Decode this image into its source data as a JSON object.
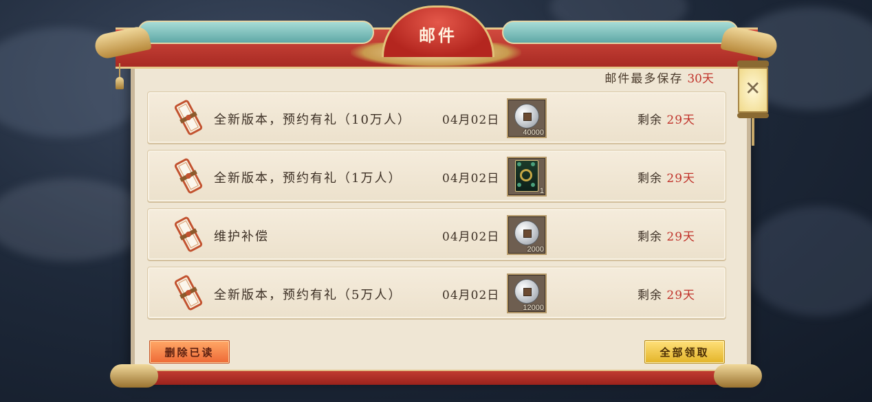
{
  "window": {
    "title": "邮件",
    "close_icon": "close-x-icon"
  },
  "retention": {
    "label": "邮件最多保存",
    "days": "30天"
  },
  "mails": [
    {
      "icon": "scroll-icon",
      "title": "全新版本，预约有礼（10万人）",
      "date": "04月02日",
      "reward": {
        "type": "silver-coin",
        "count": "40000"
      },
      "remaining_label": "剩余",
      "remaining_days": "29天"
    },
    {
      "icon": "scroll-icon",
      "title": "全新版本，预约有礼（1万人）",
      "date": "04月02日",
      "reward": {
        "type": "card",
        "count": "1"
      },
      "remaining_label": "剩余",
      "remaining_days": "29天"
    },
    {
      "icon": "scroll-icon",
      "title": "维护补偿",
      "date": "04月02日",
      "reward": {
        "type": "silver-coin",
        "count": "2000"
      },
      "remaining_label": "剩余",
      "remaining_days": "29天"
    },
    {
      "icon": "scroll-icon",
      "title": "全新版本，预约有礼（5万人）",
      "date": "04月02日",
      "reward": {
        "type": "silver-coin",
        "count": "12000"
      },
      "remaining_label": "剩余",
      "remaining_days": "29天"
    }
  ],
  "buttons": {
    "delete_read": "删除已读",
    "claim_all": "全部领取"
  },
  "colors": {
    "accent_red": "#c0322a",
    "panel_bg": "#efe6d4",
    "frame_red": "#b4261f",
    "gold": "#e2c27a"
  }
}
